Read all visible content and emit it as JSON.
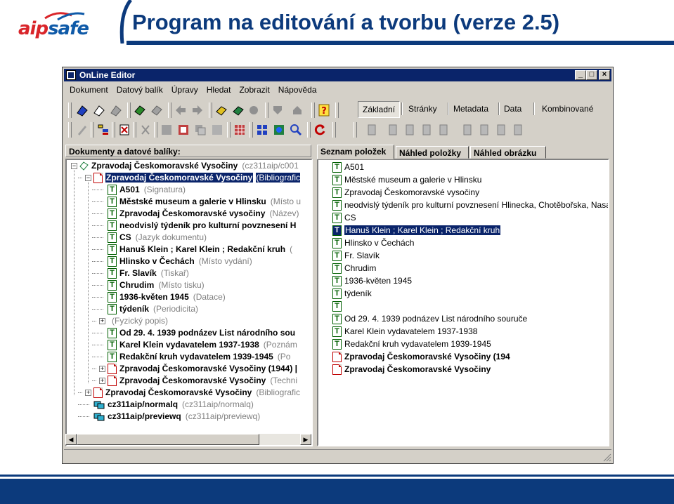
{
  "slide": {
    "logo_part1": "aip",
    "logo_part2": "safe",
    "title": "Program na editování a tvorbu (verze 2.5)"
  },
  "window": {
    "title": "OnLine Editor",
    "controls": {
      "minimize": "_",
      "maximize": "□",
      "close": "×"
    }
  },
  "menu": [
    {
      "label": "Dokument",
      "key": "D"
    },
    {
      "label": "Datový balík",
      "key": "a"
    },
    {
      "label": "Úpravy",
      "key": "Ú"
    },
    {
      "label": "Hledat",
      "key": "H"
    },
    {
      "label": "Zobrazit",
      "key": "Z"
    },
    {
      "label": "Nápověda",
      "key": "N"
    }
  ],
  "view_tabs": [
    "Základní",
    "Stránky",
    "Metadata",
    "Data",
    "Kombinované"
  ],
  "left_panel": {
    "header": "Dokumenty a datové balíky:",
    "tree": [
      {
        "label": "Zpravodaj Českomoravské Vysočiny",
        "sub": "(cz311aip/c001"
      },
      {
        "label": "Zpravodaj Českomoravské Vysočiny",
        "sub": "(Bibliografic"
      },
      {
        "label": "A501",
        "sub": "(Signatura)"
      },
      {
        "label": "Městské museum a galerie v Hlinsku",
        "sub": "(Místo u"
      },
      {
        "label": "Zpravodaj Českomoravské vysočiny",
        "sub": "(Název)"
      },
      {
        "label": "neodvislý týdeník pro kulturní povznesení H",
        "sub": ""
      },
      {
        "label": "CS",
        "sub": "(Jazyk dokumentu)"
      },
      {
        "label": "Hanuš Klein ; Karel Klein ; Redakční kruh",
        "sub": "("
      },
      {
        "label": "Hlinsko v Čechách",
        "sub": "(Místo vydání)"
      },
      {
        "label": "Fr. Slavík",
        "sub": "(Tiskař)"
      },
      {
        "label": "Chrudim",
        "sub": "(Místo tisku)"
      },
      {
        "label": "1936-květen 1945",
        "sub": "(Datace)"
      },
      {
        "label": "týdeník",
        "sub": "(Periodicita)"
      },
      {
        "label": "",
        "sub": "(Fyzický popis)"
      },
      {
        "label": "Od 29. 4. 1939 podnázev List národního sou",
        "sub": ""
      },
      {
        "label": "Karel Klein vydavatelem 1937-1938",
        "sub": "(Poznám"
      },
      {
        "label": "Redakční kruh vydavatelem 1939-1945",
        "sub": "(Po"
      },
      {
        "label": "Zpravodaj Českomoravské Vysočiny (1944) |",
        "sub": ""
      },
      {
        "label": "Zpravodaj Českomoravské Vysočiny",
        "sub": "(Techni"
      },
      {
        "label": "Zpravodaj Českomoravské Vysočiny",
        "sub": "(Bibliografic"
      },
      {
        "label": "cz311aip/normalq",
        "sub": "(cz311aip/normalq)"
      },
      {
        "label": "cz311aip/previewq",
        "sub": "(cz311aip/previewq)"
      }
    ]
  },
  "right_panel": {
    "tabs": [
      "Seznam položek",
      "Náhled položky",
      "Náhled obrázku"
    ],
    "items": [
      "A501",
      "Městské museum a galerie v Hlinsku",
      "Zpravodaj Českomoravské vysočiny",
      "neodvislý týdeník pro kulturní povznesení Hlinecka, Chotěbořska, Nasavrc",
      "CS",
      "Hanuš Klein ; Karel Klein ; Redakční kruh",
      "Hlinsko v Čechách",
      "Fr. Slavík",
      "Chrudim",
      "1936-květen 1945",
      "týdeník",
      "",
      "Od 29. 4. 1939 podnázev List národního souruče",
      "Karel Klein vydavatelem 1937-1938",
      "Redakční kruh vydavatelem 1939-1945",
      "Zpravodaj Českomoravské Vysočiny (194",
      "Zpravodaj Českomoravské Vysočiny"
    ]
  },
  "colors": {
    "brand_red": "#d9252a",
    "brand_blue": "#0f5aa8",
    "title_blue": "#0c3a7c",
    "selection": "#0a246a",
    "window_face": "#d4d0c8"
  }
}
